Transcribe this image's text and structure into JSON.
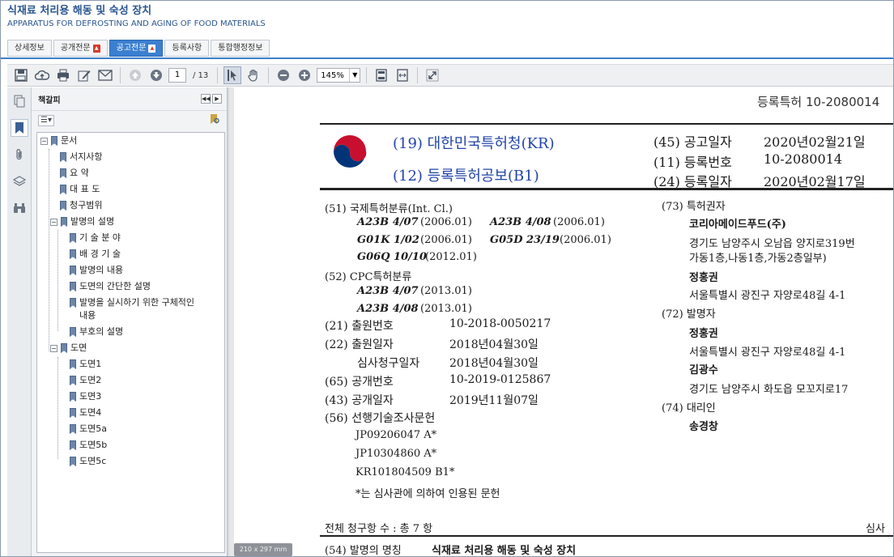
{
  "header": {
    "title_ko": "식재료 처리용 해동 및 숙성 장치",
    "title_en": "APPARATUS FOR DEFROSTING AND AGING OF FOOD MATERIALS"
  },
  "tabs": [
    {
      "label": "상세정보",
      "pdf": false
    },
    {
      "label": "공개전문",
      "pdf": true
    },
    {
      "label": "공고전문",
      "pdf": true
    },
    {
      "label": "등록사항",
      "pdf": false
    },
    {
      "label": "통합행정정보",
      "pdf": false
    }
  ],
  "active_tab": "공고전문",
  "toolbar": {
    "page_current": "1",
    "page_total": "/ 13",
    "zoom": "145%"
  },
  "colors": {
    "accent": "#3b7fd0",
    "doc_blue": "#2244a8",
    "panel": "#f1f3f5"
  },
  "bookmarks_panel": {
    "title": "책갈피",
    "tree": [
      {
        "label": "문서",
        "level": 0,
        "toggle": "−"
      },
      {
        "label": "서지사항",
        "level": 1
      },
      {
        "label": "요 약",
        "level": 1
      },
      {
        "label": "대 표 도",
        "level": 1
      },
      {
        "label": "청구범위",
        "level": 1
      },
      {
        "label": "발명의 설명",
        "level": 1,
        "toggle": "−"
      },
      {
        "label": "기 술 분 야",
        "level": 2
      },
      {
        "label": "배 경 기 술",
        "level": 2
      },
      {
        "label": "발명의 내용",
        "level": 2
      },
      {
        "label": "도면의 간단한 설명",
        "level": 2
      },
      {
        "label": "발명을 실시하기 위한 구체적인",
        "label2": "내용",
        "level": 2
      },
      {
        "label": "부호의 설명",
        "level": 2
      },
      {
        "label": "도면",
        "level": 1,
        "toggle": "−"
      },
      {
        "label": "도면1",
        "level": 2
      },
      {
        "label": "도면2",
        "level": 2
      },
      {
        "label": "도면3",
        "level": 2
      },
      {
        "label": "도면4",
        "level": 2
      },
      {
        "label": "도면5a",
        "level": 2
      },
      {
        "label": "도면5b",
        "level": 2
      },
      {
        "label": "도면5c",
        "level": 2
      }
    ]
  },
  "page_size_badge": "210 x 297 mm",
  "document": {
    "top_right": "등록특허  10-2080014",
    "office": "(19) 대한민국특허청(KR)",
    "pub_type": "(12) 등록특허공보(B1)",
    "pub_date_label": "(45) 공고일자",
    "pub_date": "2020년02월21일",
    "reg_no_label": "(11) 등록번호",
    "reg_no": "10-2080014",
    "reg_date_label": "(24) 등록일자",
    "reg_date": "2020년02월17일",
    "ipc_label": "(51) 국제특허분류(Int. Cl.)",
    "ipc": [
      {
        "code": "A23B 4/07",
        "year": "(2006.01)"
      },
      {
        "code": "A23B 4/08",
        "year": "(2006.01)"
      },
      {
        "code": "G01K 1/02",
        "year": "(2006.01)"
      },
      {
        "code": "G05D 23/19",
        "year": "(2006.01)"
      },
      {
        "code": "G06Q 10/10",
        "year": "(2012.01)"
      }
    ],
    "cpc_label": "(52) CPC특허분류",
    "cpc": [
      {
        "code": "A23B 4/07",
        "year": "(2013.01)"
      },
      {
        "code": "A23B 4/08",
        "year": "(2013.01)"
      }
    ],
    "app_no_label": "(21) 출원번호",
    "app_no": "10-2018-0050217",
    "app_date_label": "(22) 출원일자",
    "app_date": "2018년04월30일",
    "exam_date_label": "심사청구일자",
    "exam_date": "2018년04월30일",
    "open_no_label": "(65) 공개번호",
    "open_no": "10-2019-0125867",
    "open_date_label": "(43) 공개일자",
    "open_date": "2019년11월07일",
    "prior_art_label": "(56) 선행기술조사문헌",
    "prior_art": [
      "JP09206047 A*",
      "JP10304860 A*",
      "KR101804509 B1*"
    ],
    "prior_art_note": "*는 심사관에 의하여 인용된 문헌",
    "holder_label": "(73) 특허권자",
    "holder_name": "코리아메이드푸드(주)",
    "holder_addr1": "경기도 남양주시 오남읍 양지로319번",
    "holder_addr2": "가동1층,나동1층,가동2층일부)",
    "holder2_name": "정홍권",
    "holder2_addr": "서울특별시 광진구 자양로48길 4-1",
    "inventor_label": "(72) 발명자",
    "inventor1_name": "정홍권",
    "inventor1_addr": "서울특별시 광진구 자양로48길 4-1",
    "inventor2_name": "김광수",
    "inventor2_addr": "경기도 남양주시 화도읍 모꼬지로17",
    "agent_label": "(74) 대리인",
    "agent_name": "송경창",
    "claims": "전체 청구항 수 : 총  7  항",
    "examiner": "심사",
    "title_label": "(54) 발명의 명칭",
    "title_value": "식재료 처리용 해동 및 숙성 장치"
  }
}
